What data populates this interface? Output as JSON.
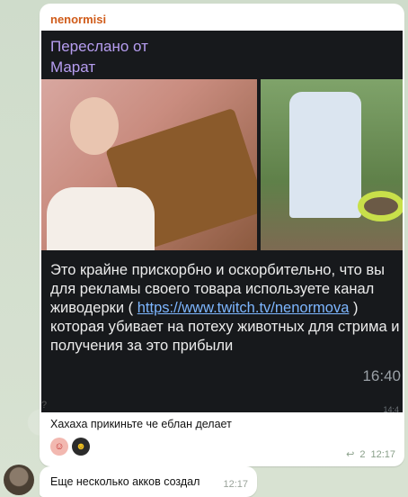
{
  "message": {
    "sender": "nenormisi",
    "forward_label": "Переслано от\nМарат",
    "caption_parts": [
      "Это крайне прискорбно и оскорбительно, что вы для рекламы своего товара используете канал живодерки ( ",
      "https://www.twitch.tv/nenormova",
      " ) которая убивает на потеху животных для стрима и получения за это прибыли"
    ],
    "forward_time": "16:40",
    "forward_time_small": "14:4",
    "stray_char": "?",
    "text": "Хахаха прикиньте че еблан делает",
    "reactions": [
      "clown",
      "monkey"
    ],
    "reply_icon": "↩",
    "replies": "2",
    "time": "12:17"
  },
  "message2": {
    "text": "Еще несколько акков создал",
    "time": "12:17"
  },
  "colors": {
    "sender": "#d05c1a",
    "forward_label": "#b69df0",
    "link": "#7db6ff",
    "bubble": "#ffffff",
    "chat_bg": "#d4dfd0"
  }
}
